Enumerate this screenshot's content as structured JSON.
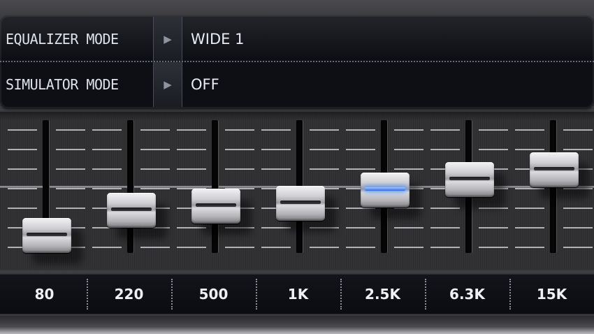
{
  "modes": [
    {
      "label": "EQUALIZER MODE",
      "value": "WIDE 1"
    },
    {
      "label": "SIMULATOR MODE",
      "value": "OFF"
    }
  ],
  "arrow_glyph": "▶",
  "arrow_icon": "play-arrow-icon",
  "accent_color": "#4f8cff",
  "bands": [
    {
      "freq": "80",
      "level": 0.15,
      "active": false
    },
    {
      "freq": "220",
      "level": 0.37,
      "active": false
    },
    {
      "freq": "500",
      "level": 0.41,
      "active": false
    },
    {
      "freq": "1K",
      "level": 0.43,
      "active": false
    },
    {
      "freq": "2.5K",
      "level": 0.55,
      "active": true
    },
    {
      "freq": "6.3K",
      "level": 0.64,
      "active": false
    },
    {
      "freq": "15K",
      "level": 0.73,
      "active": false
    }
  ]
}
